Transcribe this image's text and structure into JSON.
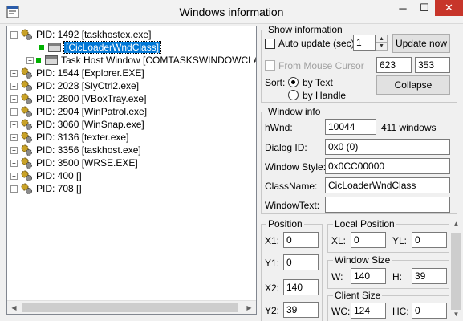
{
  "window": {
    "title": "Windows information",
    "min": "─",
    "max": "☐",
    "close": "✕"
  },
  "tree": {
    "nodes": [
      {
        "expander": "−",
        "text": "PID: 1492 [taskhostex.exe]"
      },
      {
        "text": "[CicLoaderWndClass]"
      },
      {
        "expander": "+",
        "text": "Task Host Window [COMTASKSWINDOWCLASS]"
      },
      {
        "expander": "+",
        "text": "PID: 1544 [Explorer.EXE]"
      },
      {
        "expander": "+",
        "text": "PID: 2028 [SlyCtrl2.exe]"
      },
      {
        "expander": "+",
        "text": "PID: 2800 [VBoxTray.exe]"
      },
      {
        "expander": "+",
        "text": "PID: 2904 [WinPatrol.exe]"
      },
      {
        "expander": "+",
        "text": "PID: 3060 [WinSnap.exe]"
      },
      {
        "expander": "+",
        "text": "PID: 3136 [texter.exe]"
      },
      {
        "expander": "+",
        "text": "PID: 3356 [taskhost.exe]"
      },
      {
        "expander": "+",
        "text": "PID: 3500 [WRSE.EXE]"
      },
      {
        "expander": "+",
        "text": "PID: 400 []"
      },
      {
        "expander": "+",
        "text": "PID: 708 []"
      }
    ],
    "scroll_left": "◀",
    "scroll_right": "▶"
  },
  "show_info": {
    "title": "Show information",
    "auto_update_label": "Auto update (sec)",
    "interval": "1",
    "spin_up": "▲",
    "spin_down": "▼",
    "update_now": "Update now",
    "from_mouse_label": "From Mouse Cursor",
    "mouse_x": "623",
    "mouse_y": "353",
    "sort_label": "Sort:",
    "by_text": "by Text",
    "by_handle": "by Handle",
    "collapse": "Collapse"
  },
  "window_info": {
    "title": "Window info",
    "hwnd_label": "hWnd:",
    "hwnd": "10044",
    "count": "411 windows",
    "dialog_id_label": "Dialog ID:",
    "dialog_id": "0x0 (0)",
    "style_label": "Window Style:",
    "style": "0x0CC00000",
    "classname_label": "ClassName:",
    "classname": "CicLoaderWndClass",
    "windowtext_label": "WindowText:",
    "windowtext": ""
  },
  "position": {
    "title": "Position",
    "x1_label": "X1:",
    "x1": "0",
    "y1_label": "Y1:",
    "y1": "0",
    "x2_label": "X2:",
    "x2": "140",
    "y2_label": "Y2:",
    "y2": "39"
  },
  "local_position": {
    "title": "Local Position",
    "xl_label": "XL:",
    "xl": "0",
    "yl_label": "YL:",
    "yl": "0"
  },
  "window_size": {
    "title": "Window Size",
    "w_label": "W:",
    "w": "140",
    "h_label": "H:",
    "h": "39"
  },
  "client_size": {
    "title": "Client Size",
    "wc_label": "WC:",
    "wc": "124",
    "hc_label": "HC:",
    "hc": "0"
  },
  "vscroll": {
    "up": "▲",
    "down": "▼"
  }
}
